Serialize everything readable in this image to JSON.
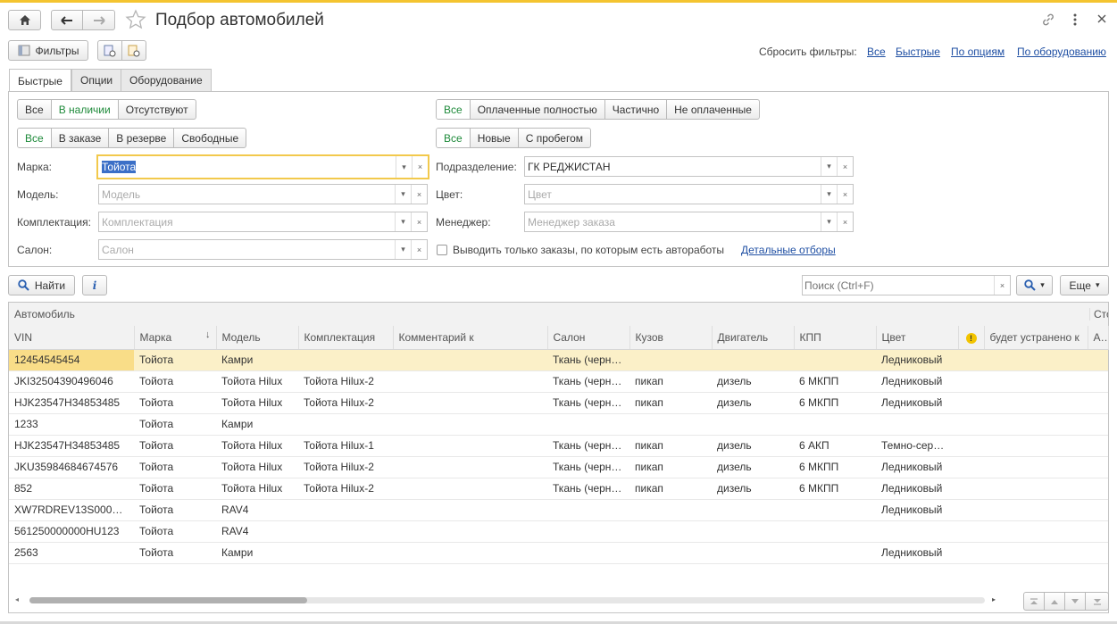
{
  "window": {
    "title": "Подбор автомобилей"
  },
  "toolbar": {
    "filters_label": "Фильтры",
    "reset_label": "Сбросить фильтры:",
    "reset_links": [
      "Все",
      "Быстрые",
      "По опциям",
      "По оборудованию"
    ]
  },
  "tabs": [
    "Быстрые",
    "Опции",
    "Оборудование"
  ],
  "quick": {
    "stock_group": [
      "Все",
      "В наличии",
      "Отсутствуют"
    ],
    "stock_active": "В наличии",
    "order_group": [
      "Все",
      "В заказе",
      "В резерве",
      "Свободные"
    ],
    "order_active": "Все",
    "payment_group": [
      "Все",
      "Оплаченные полностью",
      "Частично",
      "Не оплаченные"
    ],
    "payment_active": "Все",
    "mileage_group": [
      "Все",
      "Новые",
      "С пробегом"
    ],
    "mileage_active": "Все",
    "fields_left": [
      {
        "label": "Марка:",
        "value": "Тойота",
        "placeholder": ""
      },
      {
        "label": "Модель:",
        "value": "",
        "placeholder": "Модель"
      },
      {
        "label": "Комплектация:",
        "value": "",
        "placeholder": "Комплектация"
      },
      {
        "label": "Салон:",
        "value": "",
        "placeholder": "Салон"
      }
    ],
    "fields_right": [
      {
        "label": "Подразделение:",
        "value": "ГК РЕДЖИСТАН",
        "placeholder": ""
      },
      {
        "label": "Цвет:",
        "value": "",
        "placeholder": "Цвет"
      },
      {
        "label": "Менеджер:",
        "value": "",
        "placeholder": "Менеджер заказа"
      }
    ],
    "checkbox_label": "Выводить только заказы, по которым есть автоработы",
    "detail_link": "Детальные отборы"
  },
  "actions": {
    "find_label": "Найти",
    "info_label": "i",
    "search_placeholder": "Поиск (Ctrl+F)",
    "more_label": "Еще"
  },
  "table": {
    "group_header": "Автомобиль",
    "group_header_right": "Сто",
    "columns": [
      "VIN",
      "Марка",
      "Модель",
      "Комплектация",
      "Комментарий к",
      "Салон",
      "Кузов",
      "Двигатель",
      "КПП",
      "Цвет",
      "!",
      "будет устранено к",
      "Авт"
    ],
    "rows": [
      [
        "12454545454",
        "Тойота",
        "Камри",
        "",
        "",
        "Ткань (черн…",
        "",
        "",
        "",
        "Ледниковый",
        "",
        "",
        ""
      ],
      [
        "JKI32504390496046",
        "Тойота",
        "Тойота Hilux",
        "Тойота Hilux-2",
        "",
        "Ткань (черн…",
        "пикап",
        "дизель",
        "6 МКПП",
        "Ледниковый",
        "",
        "",
        ""
      ],
      [
        "HJK23547H34853485",
        "Тойота",
        "Тойота Hilux",
        "Тойота Hilux-2",
        "",
        "Ткань (черн…",
        "пикап",
        "дизель",
        "6 МКПП",
        "Ледниковый",
        "",
        "",
        ""
      ],
      [
        "1233",
        "Тойота",
        "Камри",
        "",
        "",
        "",
        "",
        "",
        "",
        "",
        "",
        "",
        ""
      ],
      [
        "HJK23547H34853485",
        "Тойота",
        "Тойота Hilux",
        "Тойота Hilux-1",
        "",
        "Ткань (черн…",
        "пикап",
        "дизель",
        "6 АКП",
        "Темно-сер…",
        "",
        "",
        ""
      ],
      [
        "JKU35984684674576",
        "Тойота",
        "Тойота Hilux",
        "Тойота Hilux-2",
        "",
        "Ткань (черн…",
        "пикап",
        "дизель",
        "6 МКПП",
        "Ледниковый",
        "",
        "",
        ""
      ],
      [
        "852",
        "Тойота",
        "Тойота Hilux",
        "Тойота Hilux-2",
        "",
        "Ткань (черн…",
        "пикап",
        "дизель",
        "6 МКПП",
        "Ледниковый",
        "",
        "",
        ""
      ],
      [
        "XW7RDREV13S000…",
        "Тойота",
        "RAV4",
        "",
        "",
        "",
        "",
        "",
        "",
        "Ледниковый",
        "",
        "",
        ""
      ],
      [
        "561250000000HU123",
        "Тойота",
        "RAV4",
        "",
        "",
        "",
        "",
        "",
        "",
        "",
        "",
        "",
        ""
      ],
      [
        "2563",
        "Тойота",
        "Камри",
        "",
        "",
        "",
        "",
        "",
        "",
        "Ледниковый",
        "",
        "",
        ""
      ]
    ]
  },
  "colors": {
    "accent": "#f4c430",
    "active_green": "#1e8a3a",
    "link_blue": "#1f4fa3",
    "selected_row": "#fbf0c8"
  }
}
